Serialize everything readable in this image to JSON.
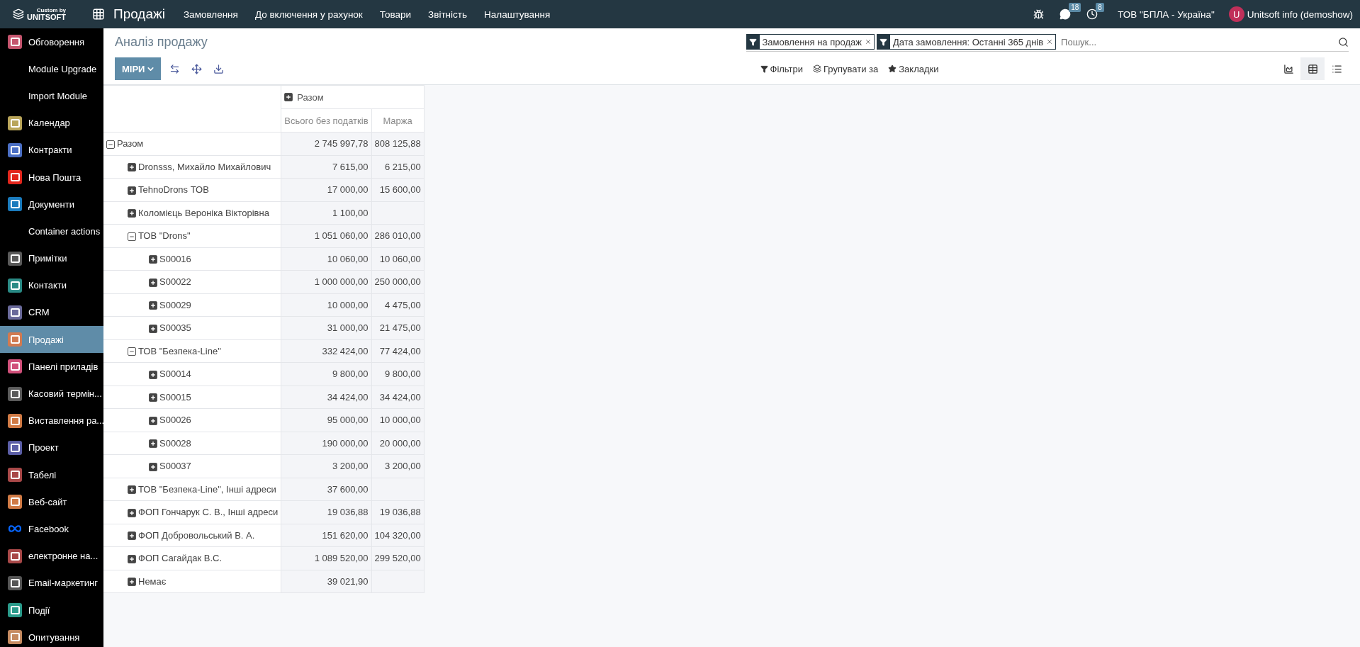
{
  "topbar": {
    "brand_small": "Custom by",
    "brand": "UNITSOFT",
    "app": "Продажі",
    "menu": [
      "Замовлення",
      "До включення у рахунок",
      "Товари",
      "Звітність",
      "Налаштування"
    ],
    "chat_count": "18",
    "activity_count": "8",
    "company": "ТОВ \"БПЛА - Україна\"",
    "avatar_letter": "U",
    "user": "Unitsoft info (demoshow)"
  },
  "sidebar": {
    "items": [
      {
        "label": "Обговорення",
        "selected": false,
        "kind": "tile",
        "color": "#c5556e"
      },
      {
        "label": "Module Upgrade",
        "selected": false,
        "kind": "none"
      },
      {
        "label": "Import Module",
        "selected": false,
        "kind": "none"
      },
      {
        "label": "Календар",
        "selected": false,
        "kind": "tile",
        "color": "#b9a55a"
      },
      {
        "label": "Контракти",
        "selected": false,
        "kind": "tile",
        "color": "#4b6fc4"
      },
      {
        "label": "Нова Пошта",
        "selected": false,
        "kind": "tile",
        "color": "#e2261c"
      },
      {
        "label": "Документи",
        "selected": false,
        "kind": "tile",
        "color": "#1a7bbd"
      },
      {
        "label": "Container actions",
        "selected": false,
        "kind": "none"
      },
      {
        "label": "Примітки",
        "selected": false,
        "kind": "tile",
        "color": "#5a5a5a"
      },
      {
        "label": "Контакти",
        "selected": false,
        "kind": "tile",
        "color": "#2a8a85"
      },
      {
        "label": "CRM",
        "selected": false,
        "kind": "tile",
        "color": "#6a6a9a"
      },
      {
        "label": "Продажі",
        "selected": true,
        "kind": "tile",
        "color": "#d27a50"
      },
      {
        "label": "Панелі приладів",
        "selected": false,
        "kind": "tile",
        "color": "#d0507a"
      },
      {
        "label": "Касовий термін...",
        "selected": false,
        "kind": "tile",
        "color": "#5a5a5a"
      },
      {
        "label": "Виставлення ра...",
        "selected": false,
        "kind": "tile",
        "color": "#d07a45"
      },
      {
        "label": "Проект",
        "selected": false,
        "kind": "tile",
        "color": "#5b5ea6"
      },
      {
        "label": "Табелі",
        "selected": false,
        "kind": "tile",
        "color": "#a84848"
      },
      {
        "label": "Веб-сайт",
        "selected": false,
        "kind": "tile",
        "color": "#d07a45"
      },
      {
        "label": "Facebook",
        "selected": false,
        "kind": "logo",
        "color": "#0866ff"
      },
      {
        "label": "електронне на...",
        "selected": false,
        "kind": "tile",
        "color": "#a84848"
      },
      {
        "label": "Email-маркетинг",
        "selected": false,
        "kind": "tile",
        "color": "#555555"
      },
      {
        "label": "Події",
        "selected": false,
        "kind": "tile",
        "color": "#2a9a8a"
      },
      {
        "label": "Опитування",
        "selected": false,
        "kind": "tile",
        "color": "#c58a60"
      }
    ]
  },
  "control_panel": {
    "title": "Аналіз продажу",
    "measures_button": "МІРИ",
    "facets": [
      {
        "label": "Замовлення на продаж"
      },
      {
        "label": "Дата замовлення: Останні 365 днів"
      }
    ],
    "search": {
      "placeholder": "Пошук..."
    },
    "filters": "Фільтри",
    "group_by": "Групувати за",
    "favorites": "Закладки",
    "views": [
      {
        "kind": "graph",
        "selected": false
      },
      {
        "kind": "pivot",
        "selected": true
      },
      {
        "kind": "list",
        "selected": false
      }
    ]
  },
  "pivot": {
    "column_group": {
      "label": "Разом",
      "expanded": false
    },
    "measures": [
      "Всього без податків",
      "Маржа"
    ],
    "rows": [
      {
        "label": "Разом",
        "expanded": true,
        "values": [
          "2 745 997,78",
          "808 125,88"
        ],
        "children": [
          {
            "label": "Dronsss, Михайло Михайлович",
            "expanded": false,
            "values": [
              "7 615,00",
              "6 215,00"
            ]
          },
          {
            "label": "TehnoDrons ТОВ",
            "expanded": false,
            "values": [
              "17 000,00",
              "15 600,00"
            ]
          },
          {
            "label": "Коломієць Вероніка Вікторівна",
            "expanded": false,
            "values": [
              "1 100,00"
            ]
          },
          {
            "label": "ТОВ \"Drons\"",
            "expanded": true,
            "values": [
              "1 051 060,00",
              "286 010,00"
            ],
            "children": [
              {
                "label": "S00016",
                "expanded": false,
                "values": [
                  "10 060,00",
                  "10 060,00"
                ]
              },
              {
                "label": "S00022",
                "expanded": false,
                "values": [
                  "1 000 000,00",
                  "250 000,00"
                ]
              },
              {
                "label": "S00029",
                "expanded": false,
                "values": [
                  "10 000,00",
                  "4 475,00"
                ]
              },
              {
                "label": "S00035",
                "expanded": false,
                "values": [
                  "31 000,00",
                  "21 475,00"
                ]
              }
            ]
          },
          {
            "label": "ТОВ \"Безпека-Line\"",
            "expanded": true,
            "values": [
              "332 424,00",
              "77 424,00"
            ],
            "children": [
              {
                "label": "S00014",
                "expanded": false,
                "values": [
                  "9 800,00",
                  "9 800,00"
                ]
              },
              {
                "label": "S00015",
                "expanded": false,
                "values": [
                  "34 424,00",
                  "34 424,00"
                ]
              },
              {
                "label": "S00026",
                "expanded": false,
                "values": [
                  "95 000,00",
                  "10 000,00"
                ]
              },
              {
                "label": "S00028",
                "expanded": false,
                "values": [
                  "190 000,00",
                  "20 000,00"
                ]
              },
              {
                "label": "S00037",
                "expanded": false,
                "values": [
                  "3 200,00",
                  "3 200,00"
                ]
              }
            ]
          },
          {
            "label": "ТОВ \"Безпека-Line\", Інші адреси",
            "expanded": false,
            "values": [
              "37 600,00"
            ]
          },
          {
            "label": "ФОП Гончарук С. В., Інші адреси",
            "expanded": false,
            "values": [
              "19 036,88",
              "19 036,88"
            ]
          },
          {
            "label": "ФОП Добровольський В. А.",
            "expanded": false,
            "values": [
              "151 620,00",
              "104 320,00"
            ]
          },
          {
            "label": "ФОП Сагайдак В.С.",
            "expanded": false,
            "values": [
              "1 089 520,00",
              "299 520,00"
            ]
          },
          {
            "label": "Немає",
            "expanded": false,
            "values": [
              "39 021,90"
            ]
          }
        ]
      }
    ]
  }
}
